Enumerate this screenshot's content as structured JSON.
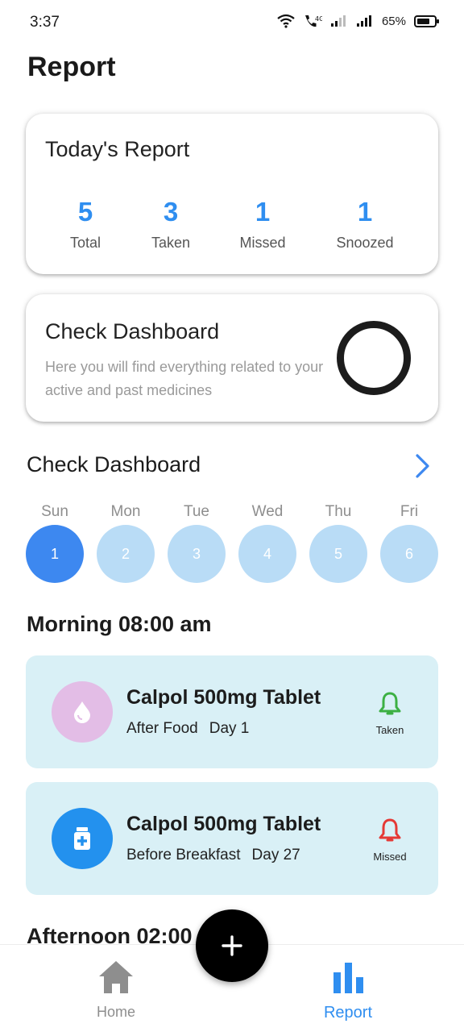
{
  "status_bar": {
    "time": "3:37",
    "battery": "65%"
  },
  "page_title": "Report",
  "todays_report": {
    "title": "Today's Report",
    "stats": [
      {
        "value": "5",
        "label": "Total"
      },
      {
        "value": "3",
        "label": "Taken"
      },
      {
        "value": "1",
        "label": "Missed"
      },
      {
        "value": "1",
        "label": "Snoozed"
      }
    ]
  },
  "dashboard_card": {
    "title": "Check Dashboard",
    "description": "Here you will find everything related to your active and past medicines"
  },
  "dashboard_section": {
    "title": "Check Dashboard"
  },
  "days": [
    {
      "name": "Sun",
      "date": "1",
      "active": true
    },
    {
      "name": "Mon",
      "date": "2",
      "active": false
    },
    {
      "name": "Tue",
      "date": "3",
      "active": false
    },
    {
      "name": "Wed",
      "date": "4",
      "active": false
    },
    {
      "name": "Thu",
      "date": "5",
      "active": false
    },
    {
      "name": "Fri",
      "date": "6",
      "active": false
    }
  ],
  "morning": {
    "title": "Morning 08:00 am",
    "medicines": [
      {
        "name": "Calpol 500mg Tablet",
        "timing": "After Food",
        "day": "Day 1",
        "status": "Taken",
        "status_color": "#3cb043",
        "icon": "drop-icon",
        "icon_bg": "#e3bde6"
      },
      {
        "name": "Calpol 500mg Tablet",
        "timing": "Before Breakfast",
        "day": "Day 27",
        "status": "Missed",
        "status_color": "#e53935",
        "icon": "pill-bottle-icon",
        "icon_bg": "#2391ee"
      }
    ]
  },
  "afternoon": {
    "title": "Afternoon 02:00"
  },
  "bottom_nav": {
    "home_label": "Home",
    "report_label": "Report",
    "active_color": "#2f8ef0",
    "inactive_color": "#8e8e8e"
  }
}
